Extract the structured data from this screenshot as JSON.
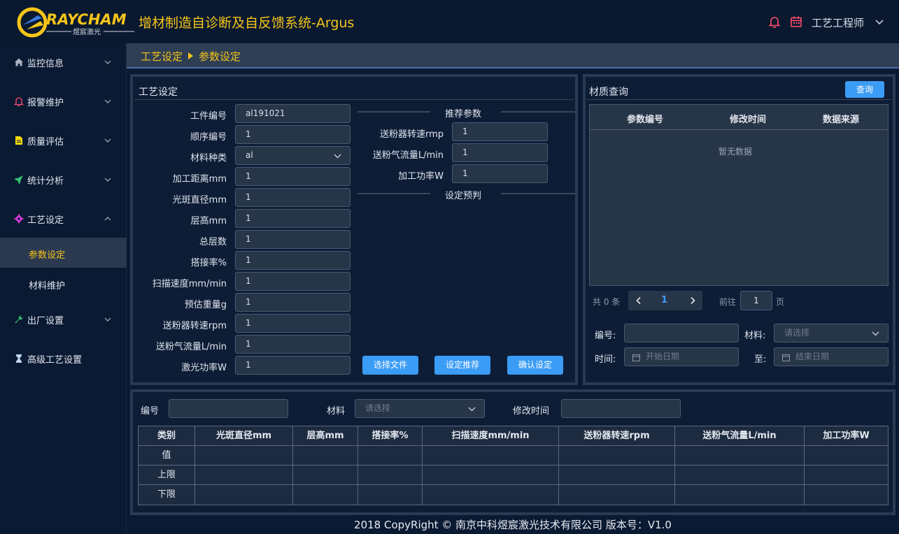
{
  "header": {
    "logo_text": "RAYCHAM",
    "logo_sub": "煜宸激光",
    "system_title": "增材制造自诊断及自反馈系统-Argus",
    "user": "工艺工程师"
  },
  "sidebar": {
    "items": [
      {
        "label": "监控信息",
        "icon": "home-icon"
      },
      {
        "label": "报警维护",
        "icon": "bell-icon"
      },
      {
        "label": "质量评估",
        "icon": "document-icon"
      },
      {
        "label": "统计分析",
        "icon": "rocket-icon"
      },
      {
        "label": "工艺设定",
        "icon": "gear-icon"
      },
      {
        "label": "出厂设置",
        "icon": "wrench-icon"
      },
      {
        "label": "高级工艺设置",
        "icon": "hourglass-icon"
      }
    ],
    "sub_items": [
      {
        "label": "参数设定"
      },
      {
        "label": "材料维护"
      }
    ]
  },
  "breadcrumb": {
    "parent": "工艺设定",
    "current": "参数设定"
  },
  "settings_panel": {
    "title": "工艺设定",
    "fields": [
      {
        "label": "工件编号",
        "value": "al191021"
      },
      {
        "label": "顺序编号",
        "value": "1"
      },
      {
        "label": "材料种类",
        "value": "al"
      },
      {
        "label": "加工距离mm",
        "value": "1"
      },
      {
        "label": "光斑直径mm",
        "value": "1"
      },
      {
        "label": "层高mm",
        "value": "1"
      },
      {
        "label": "总层数",
        "value": "1"
      },
      {
        "label": "搭接率%",
        "value": "1"
      },
      {
        "label": "扫描速度mm/min",
        "value": "1"
      },
      {
        "label": "预估重量g",
        "value": "1"
      },
      {
        "label": "送粉器转速rpm",
        "value": "1"
      },
      {
        "label": "送粉气流量L/min",
        "value": "1"
      },
      {
        "label": "激光功率W",
        "value": "1"
      }
    ],
    "recommend_title": "推荐参数",
    "recommend": [
      {
        "label": "送粉器转速rmp",
        "value": "1"
      },
      {
        "label": "送粉气流量L/min",
        "value": "1"
      },
      {
        "label": "加工功率W",
        "value": "1"
      }
    ],
    "predict_title": "设定预判",
    "buttons": {
      "choose_file": "选择文件",
      "set_recommend": "设定推荐",
      "confirm": "确认设定"
    }
  },
  "material_panel": {
    "title": "材质查询",
    "query_button": "查询",
    "columns": [
      "参数编号",
      "修改时间",
      "数据来源"
    ],
    "empty_text": "暂无数据",
    "pagination": {
      "total": "共 0 条",
      "current_page": "1",
      "goto_prefix": "前往",
      "goto_value": "1",
      "goto_suffix": "页"
    },
    "filters": {
      "code_label": "编号:",
      "material_label": "材料:",
      "material_placeholder": "请选择",
      "time_label": "时间:",
      "start_placeholder": "开始日期",
      "to_label": "至:",
      "end_placeholder": "结束日期"
    }
  },
  "bottom_panel": {
    "code_label": "编号",
    "material_label": "材料",
    "material_placeholder": "请选择",
    "time_label": "修改时间",
    "columns": [
      "类别",
      "光斑直径mm",
      "层高mm",
      "搭接率%",
      "扫描速度mm/min",
      "送粉器转速rpm",
      "送粉气流量L/min",
      "加工功率W"
    ],
    "rows": [
      "值",
      "上限",
      "下限"
    ]
  },
  "footer": "2018 CopyRight © 南京中科煜宸激光技术有限公司 版本号：V1.0",
  "colors": {
    "accent": "#f5c518",
    "primary_button": "#3b9cf5",
    "background": "#0b1a33"
  }
}
